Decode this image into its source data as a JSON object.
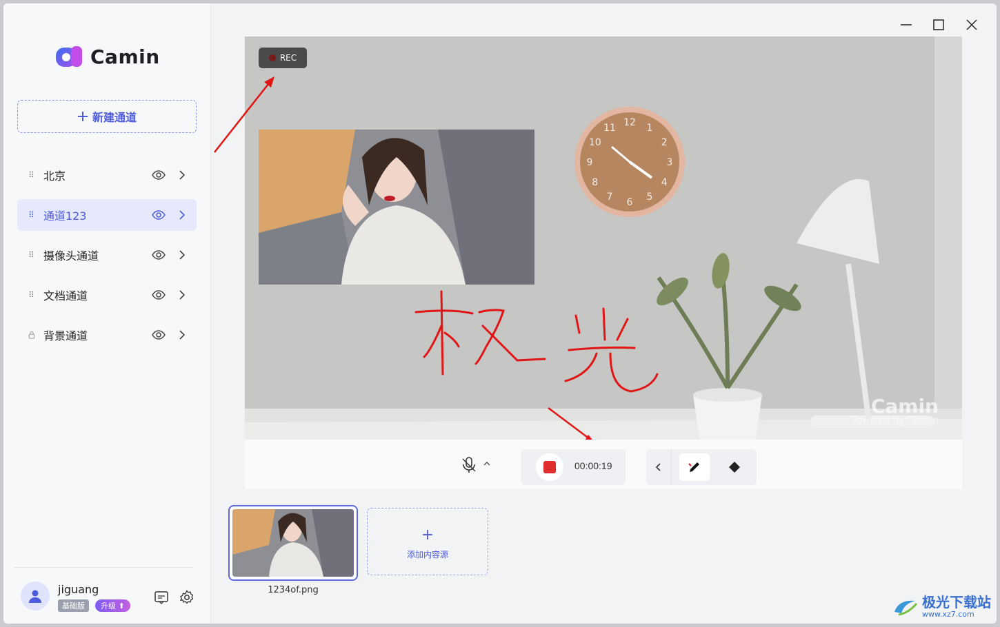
{
  "app": {
    "name": "Camin"
  },
  "sidebar": {
    "new_channel_label": "新建通道",
    "channels": [
      {
        "label": "北京",
        "locked": false,
        "active": false
      },
      {
        "label": "通道123",
        "locked": false,
        "active": true
      },
      {
        "label": "摄像头通道",
        "locked": false,
        "active": false
      },
      {
        "label": "文档通道",
        "locked": false,
        "active": false
      },
      {
        "label": "背景通道",
        "locked": true,
        "active": false
      }
    ],
    "user": {
      "name": "jiguang",
      "plan": "基础版",
      "upgrade": "升级"
    }
  },
  "preview": {
    "rec_label": "REC",
    "handwriting": "极光",
    "watermark": "Camin",
    "watermark_sub": "Powered by ClassIn",
    "clock_numbers": [
      "12",
      "1",
      "2",
      "3",
      "4",
      "5",
      "6",
      "7",
      "8",
      "9",
      "10",
      "11"
    ]
  },
  "controls": {
    "timer": "00:00:19"
  },
  "sources": {
    "items": [
      {
        "name": "1234of.png"
      }
    ],
    "add_label": "添加内容源"
  },
  "site": {
    "name": "极光下载站",
    "url": "www.xz7.com"
  },
  "colors": {
    "accent": "#4d5bdc",
    "stop": "#e02d2d",
    "annotation": "#e01515"
  }
}
